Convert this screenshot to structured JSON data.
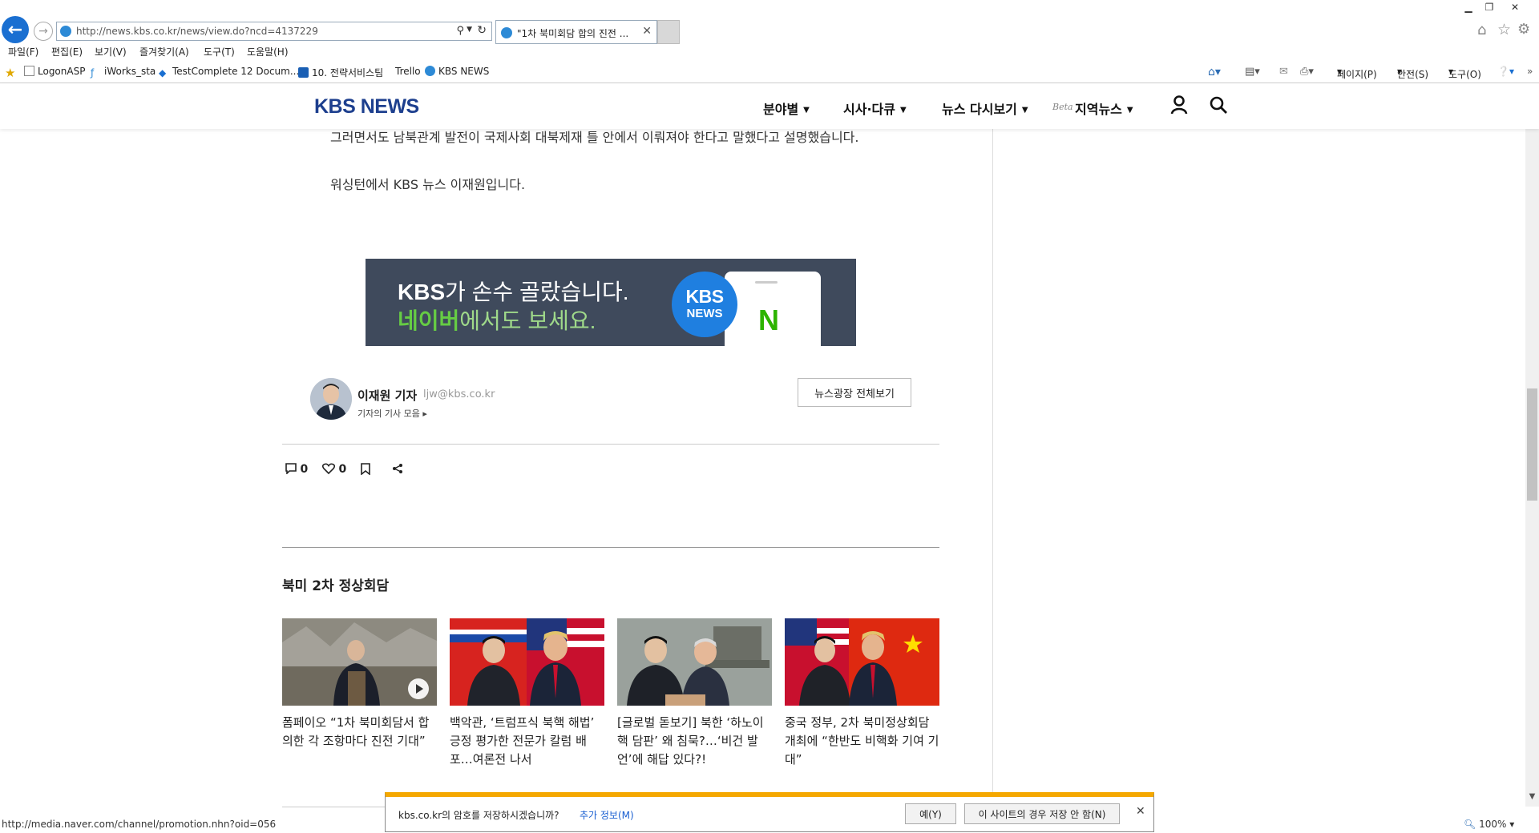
{
  "browser": {
    "address": "http://news.kbs.co.kr/news/view.do?ncd=4137229",
    "tab_title": "\"1차 북미회담 합의 진전 ...",
    "menu": [
      "파일(F)",
      "편집(E)",
      "보기(V)",
      "즐겨찾기(A)",
      "도구(T)",
      "도움말(H)"
    ],
    "favorites": [
      "LogonASP",
      "iWorks_sta",
      "TestComplete 12 Docum...",
      "10. 전략서비스팀",
      "Trello",
      "KBS NEWS"
    ],
    "command_bar": [
      "페이지(P)",
      "안전(S)",
      "도구(O)"
    ],
    "status_url": "http://media.naver.com/channel/promotion.nhn?oid=056",
    "zoom": "100%"
  },
  "site": {
    "logo": "KBS NEWS",
    "nav": [
      "분야별",
      "시사·다큐",
      "뉴스 다시보기",
      "지역뉴스"
    ],
    "nav_beta": "Beta",
    "accent_color": "#1d3f8e"
  },
  "article": {
    "para1": "그러면서도 남북관계 발전이 국제사회 대북제재 틀 안에서 이뤄져야 한다고 말했다고 설명했습니다.",
    "para2": "워싱턴에서 KBS 뉴스 이재원입니다."
  },
  "banner": {
    "line1_bold": "KBS",
    "line1_rest": "가 손수 골랐습니다.",
    "line2_bold": "네이버",
    "line2_rest": "에서도 보세요.",
    "bubble_top": "KBS",
    "bubble_bottom": "NEWS",
    "naver_mark": "N"
  },
  "reporter": {
    "name": "이재원 기자",
    "email": "ljw@kbs.co.kr",
    "more": "기자의 기사 모음 ▸",
    "all_button": "뉴스광장 전체보기"
  },
  "actions": {
    "comments": "0",
    "likes": "0"
  },
  "related": {
    "section_title": "북미 2차 정상회담",
    "items": [
      {
        "title": "폼페이오 “1차 북미회담서 합의한 각 조항마다 진전 기대”"
      },
      {
        "title": "백악관, ‘트럼프식 북핵 해법’ 긍정 평가한 전문가 칼럼 배포…여론전 나서"
      },
      {
        "title": "[글로벌 돋보기] 북한 ‘하노이 핵 담판’ 왜 침묵?…‘비건 발언’에 해답 있다?!"
      },
      {
        "title": "중국 정부, 2차 북미정상회담 개최에 “한반도 비핵화 기여 기대”"
      }
    ]
  },
  "notification": {
    "text": "kbs.co.kr의 암호를 저장하시겠습니까?",
    "more": "추가 정보(M)",
    "yes": "예(Y)",
    "never": "이 사이트의 경우 저장 안 함(N)"
  }
}
